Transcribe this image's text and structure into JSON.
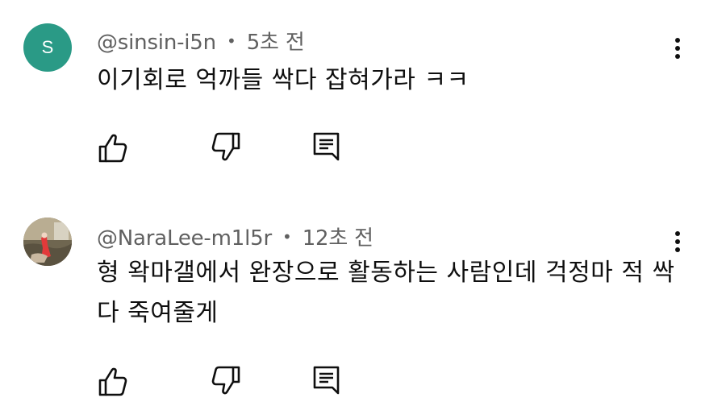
{
  "comments": [
    {
      "avatar_letter": "S",
      "avatar_color": "#2a9a86",
      "handle": "@sinsin-i5n",
      "separator": "•",
      "time": "5초 전",
      "text": "이기회로 억까들 싹다 잡혀가라 ㅋㅋ",
      "icons": {
        "more": "more-vert-icon",
        "like": "thumb-up-icon",
        "dislike": "thumb-down-icon",
        "reply": "reply-comment-icon"
      }
    },
    {
      "avatar_letter": "",
      "handle": "@NaraLee-m1l5r",
      "separator": "•",
      "time": "12초 전",
      "text": "형 왁마갤에서 완장으로 활동하는 사람인데 걱정마 적 싹다 죽여줄게",
      "icons": {
        "more": "more-vert-icon",
        "like": "thumb-up-icon",
        "dislike": "thumb-down-icon",
        "reply": "reply-comment-icon"
      }
    }
  ]
}
